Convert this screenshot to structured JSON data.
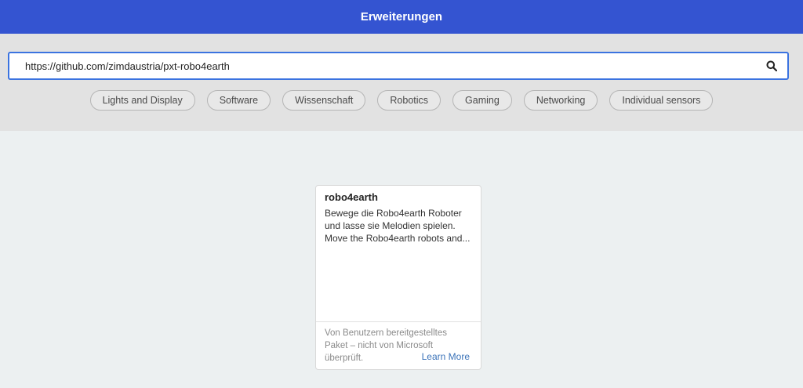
{
  "header": {
    "title": "Erweiterungen"
  },
  "search": {
    "value": "https://github.com/zimdaustria/pxt-robo4earth",
    "icon": "search-icon"
  },
  "tags": [
    "Lights and Display",
    "Software",
    "Wissenschaft",
    "Robotics",
    "Gaming",
    "Networking",
    "Individual sensors"
  ],
  "card": {
    "title": "robo4earth",
    "description_lines": [
      "Bewege die Robo4earth Roboter",
      "und lasse sie Melodien spielen.",
      "Move the Robo4earth robots and..."
    ],
    "footer_lines": [
      "Von Benutzern bereitgestelltes",
      "Paket – nicht von Microsoft",
      "überprüft."
    ],
    "learn_more": "Learn More"
  },
  "colors": {
    "header_bg": "#3454d1",
    "search_border": "#3b73e0",
    "link": "#3b73b9"
  }
}
